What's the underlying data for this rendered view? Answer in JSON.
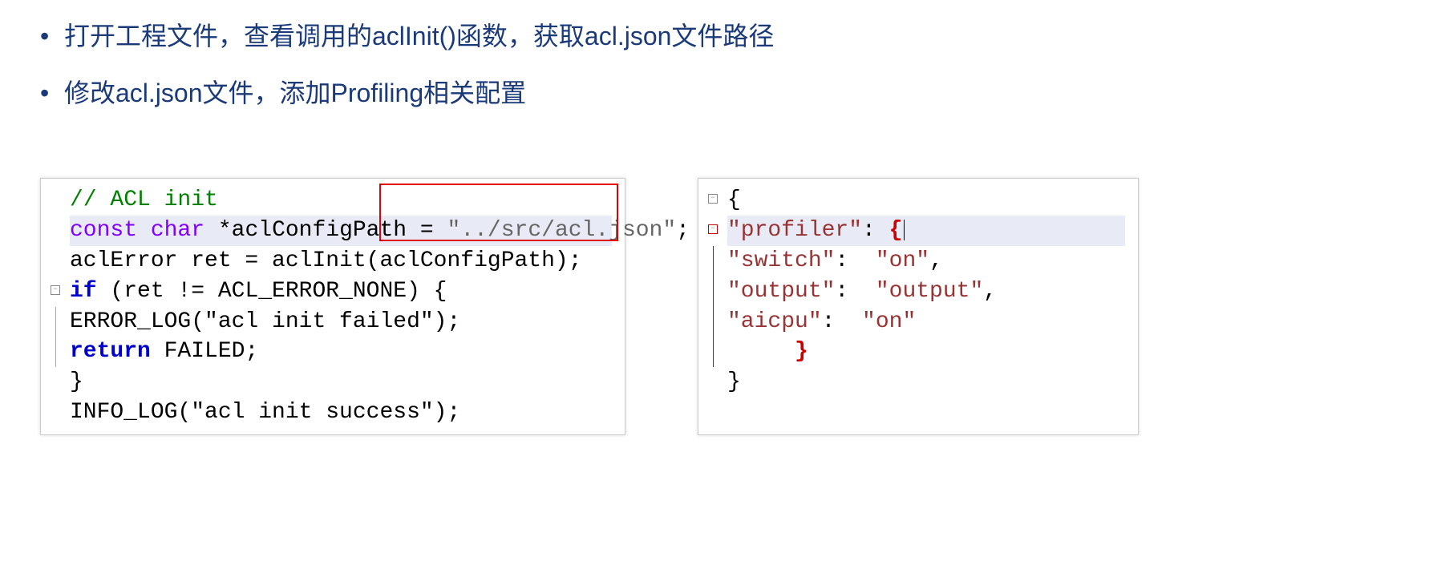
{
  "bullets": {
    "item1": "打开工程文件，查看调用的aclInit()函数，获取acl.json文件路径",
    "item2": "修改acl.json文件，添加Profiling相关配置"
  },
  "code_left": {
    "l1_comment": "// ACL init",
    "l2_kw": "const char ",
    "l2_star": "*",
    "l2_var": "aclConfigPath ",
    "l2_eq": "= ",
    "l2_str": "\"../src/acl.json\"",
    "l2_semi": ";",
    "l3": "aclError ret = aclInit(aclConfigPath);",
    "l4_if": "if",
    "l4_rest": " (ret != ACL_ERROR_NONE) {",
    "l5": "ERROR_LOG(\"acl init failed\");",
    "l6_ret": "return",
    "l6_rest": " FAILED;",
    "l7": "}",
    "l8": "INFO_LOG(\"acl init success\");"
  },
  "code_right": {
    "l1": "{",
    "l2_key": "\"profiler\"",
    "l2_colon": ": ",
    "l2_brace": "{",
    "l3_key": "\"switch\"",
    "l3_colon": ":  ",
    "l3_val": "\"on\"",
    "l3_comma": ",",
    "l4_key": "\"output\"",
    "l4_colon": ":  ",
    "l4_val": "\"output\"",
    "l4_comma": ",",
    "l5_key": "\"aicpu\"",
    "l5_colon": ":  ",
    "l5_val": "\"on\"",
    "l6": "     }",
    "l7": "}"
  }
}
